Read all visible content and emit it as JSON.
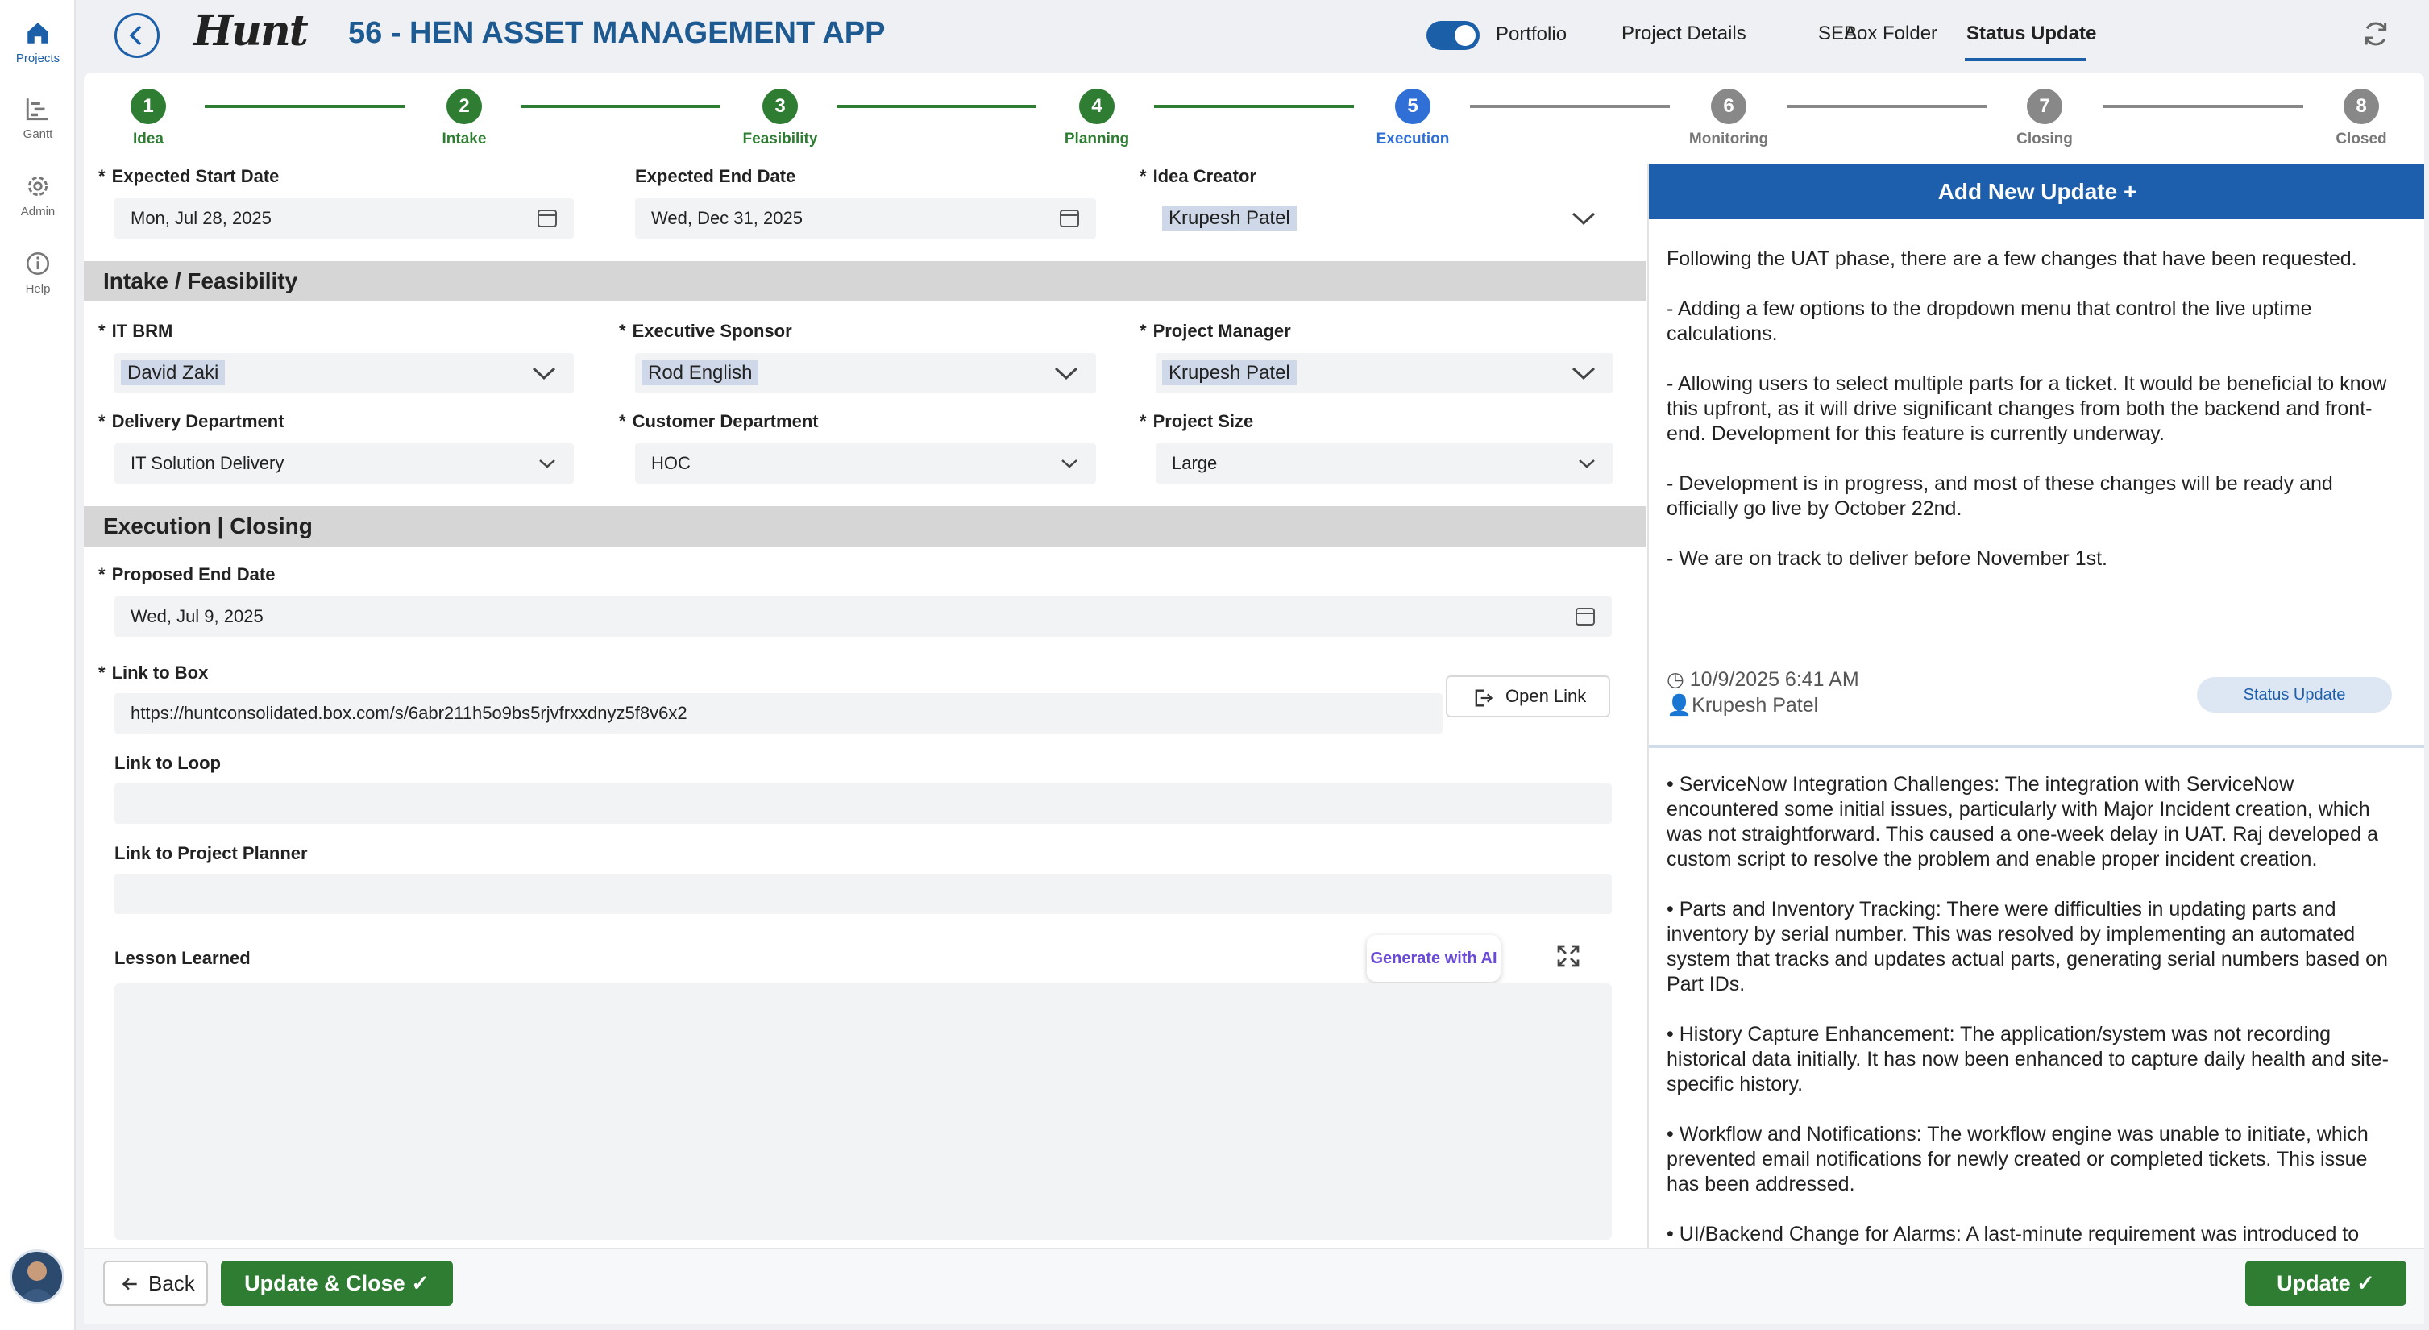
{
  "rail": {
    "items": [
      {
        "label": "Projects",
        "icon": "home-icon"
      },
      {
        "label": "Gantt",
        "icon": "gantt-icon"
      },
      {
        "label": "Admin",
        "icon": "gear-icon"
      },
      {
        "label": "Help",
        "icon": "info-icon"
      }
    ]
  },
  "header": {
    "logo_text": "Hunt",
    "title": "56 - HEN ASSET MANAGEMENT APP",
    "toggle_label": "Portfolio",
    "tabs": [
      "Project Details",
      "SEA",
      "Box Folder",
      "Status Update"
    ],
    "active_tab": "Status Update"
  },
  "stepper": [
    {
      "num": "1",
      "label": "Idea",
      "state": "done"
    },
    {
      "num": "2",
      "label": "Intake",
      "state": "done"
    },
    {
      "num": "3",
      "label": "Feasibility",
      "state": "done"
    },
    {
      "num": "4",
      "label": "Planning",
      "state": "done"
    },
    {
      "num": "5",
      "label": "Execution",
      "state": "current"
    },
    {
      "num": "6",
      "label": "Monitoring",
      "state": "future"
    },
    {
      "num": "7",
      "label": "Closing",
      "state": "future"
    },
    {
      "num": "8",
      "label": "Closed",
      "state": "future"
    }
  ],
  "form": {
    "expected_start_label": "Expected Start Date",
    "expected_start_value": "Mon, Jul 28, 2025",
    "expected_end_label": "Expected End Date",
    "expected_end_value": "Wed, Dec 31, 2025",
    "idea_creator_label": "Idea Creator",
    "idea_creator_value": "Krupesh Patel",
    "section_intake": "Intake / Feasibility",
    "it_brm_label": "IT BRM",
    "it_brm_value": "David Zaki",
    "exec_sponsor_label": "Executive Sponsor",
    "exec_sponsor_value": "Rod English",
    "pm_label": "Project Manager",
    "pm_value": "Krupesh Patel",
    "delivery_dept_label": "Delivery Department",
    "delivery_dept_value": "IT Solution Delivery",
    "customer_dept_label": "Customer Department",
    "customer_dept_value": "HOC",
    "project_size_label": "Project Size",
    "project_size_value": "Large",
    "section_exec": "Execution | Closing",
    "proposed_end_label": "Proposed End Date",
    "proposed_end_value": "Wed, Jul 9, 2025",
    "link_box_label": "Link to Box",
    "link_box_value": "https://huntconsolidated.box.com/s/6abr211h5o9bs5rjvfrxxdnyz5f8v6x2",
    "open_link": "Open Link",
    "link_loop_label": "Link to Loop",
    "link_loop_value": "",
    "link_planner_label": "Link to Project Planner",
    "link_planner_value": "",
    "lesson_label": "Lesson Learned",
    "generate_ai": "Generate with AI",
    "required_mark": "*"
  },
  "updates": {
    "add_label": "Add New Update +",
    "first": {
      "paragraphs": [
        "Following the UAT phase, there are a few changes that have been requested.",
        "- Adding a few options to the dropdown menu that control the live uptime calculations.",
        "- Allowing users to select multiple parts for a ticket. It would be beneficial to know this upfront, as it will drive significant changes from both the backend and front-end. Development for this feature is currently underway.",
        "- Development is in progress, and most of these changes will be ready and officially go live by October 22nd.",
        "- We are on track to deliver before November 1st."
      ],
      "timestamp": "10/9/2025 6:41 AM",
      "author": "Krupesh Patel",
      "badge": "Status Update"
    },
    "second": {
      "paragraphs": [
        "• ServiceNow Integration Challenges: The integration with ServiceNow encountered some initial issues, particularly with Major Incident creation, which was not straightforward. This caused a one-week delay in UAT. Raj developed a custom script to resolve the problem and enable proper incident creation.",
        "• Parts and Inventory Tracking: There were difficulties in updating parts and inventory by serial number. This was resolved by implementing an automated system that tracks and updates actual parts, generating serial numbers based on Part IDs.",
        "• History Capture Enhancement: The application/system was not recording historical data initially. It has now been enhanced to capture daily health and site-specific history.",
        "• Workflow and Notifications: The workflow engine was unable to initiate, which prevented email notifications for newly created or completed tickets. This issue has been addressed.",
        "• UI/Backend Change for Alarms: A last-minute requirement was introduced to support multiple alarm descriptions per ticket. Corresponding UI and backend changes were implemented to accommodate this."
      ]
    }
  },
  "footer": {
    "back": "Back",
    "update_close": "Update & Close ✓",
    "update": "Update ✓"
  },
  "colors": {
    "accent": "#1b5fa9",
    "green": "#2e7d32",
    "current_step": "#2f6fd6"
  }
}
